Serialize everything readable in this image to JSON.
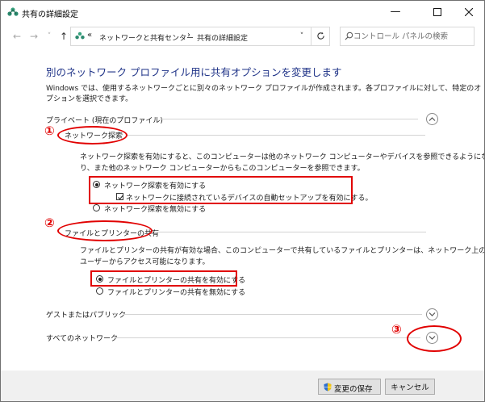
{
  "window": {
    "title": "共有の詳細設定"
  },
  "nav": {
    "breadcrumb": [
      "ネットワークと共有センター",
      "共有の詳細設定"
    ],
    "breadcrumb_prefix": "«",
    "breadcrumb_sep": "›",
    "search_placeholder": "コントロール パネルの検索"
  },
  "page": {
    "heading": "別のネットワーク プロファイル用に共有オプションを変更します",
    "description_line1": "Windows では、使用するネットワークごとに別々のネットワーク プロファイルが作成されます。各プロファイルに対して、特定のオ",
    "description_line2": "プションを選択できます。"
  },
  "private": {
    "label": "プライベート (現在のプロファイル)",
    "discovery": {
      "title": "ネットワーク探索",
      "desc_line1": "ネットワーク探索を有効にすると、このコンピューターは他のネットワーク コンピューターやデバイスを参照できるようにな",
      "desc_line2": "り、また他のネットワーク コンピューターからもこのコンピューターを参照できます。",
      "on_label": "ネットワーク探索を有効にする",
      "auto_setup_label": "ネットワークに接続されているデバイスの自動セットアップを有効にする。",
      "off_label": "ネットワーク探索を無効にする"
    },
    "sharing": {
      "title": "ファイルとプリンターの共有",
      "desc_line1": "ファイルとプリンターの共有が有効な場合、このコンピューターで共有しているファイルとプリンターは、ネットワーク上の",
      "desc_line2": "ユーザーからアクセス可能になります。",
      "on_label": "ファイルとプリンターの共有を有効にする",
      "off_label": "ファイルとプリンターの共有を無効にする"
    }
  },
  "guest": {
    "label": "ゲストまたはパブリック"
  },
  "all": {
    "label": "すべてのネットワーク"
  },
  "annotations": {
    "n1": "①",
    "n2": "②",
    "n3": "③"
  },
  "footer": {
    "save_label": "変更の保存",
    "cancel_label": "キャンセル"
  },
  "colors": {
    "heading": "#1e3287",
    "annotation": "#e10000",
    "footer_bg": "#f0f0f0"
  }
}
